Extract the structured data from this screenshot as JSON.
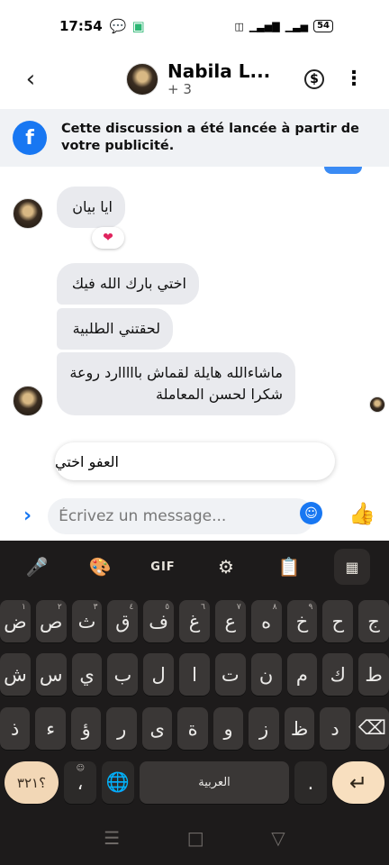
{
  "status": {
    "time": "17:54",
    "battery": "54"
  },
  "header": {
    "title": "Nabila L...",
    "subtitle": "+ 3"
  },
  "banner": {
    "text": "Cette discussion a été lancée à partir de votre publicité."
  },
  "messages": [
    {
      "text": "ايا بيان"
    },
    {
      "text": "اختي بارك الله فيك"
    },
    {
      "text": "لحقتني الطلبية"
    },
    {
      "text": "ماشاءالله هايلة لقماش بااااارد روعة شكرا لحسن المعاملة"
    }
  ],
  "reaction": "❤",
  "quick_reply": "العفو اختي",
  "composer": {
    "placeholder": "Écrivez un message..."
  },
  "keyboard": {
    "toolbar": [
      "mic",
      "palette",
      "GIF",
      "settings",
      "clipboard",
      "grid"
    ],
    "row1": [
      {
        "k": "ج",
        "h": ""
      },
      {
        "k": "ح",
        "h": ""
      },
      {
        "k": "خ",
        "h": "٩"
      },
      {
        "k": "ه",
        "h": "٨"
      },
      {
        "k": "ع",
        "h": "٧"
      },
      {
        "k": "غ",
        "h": "٦"
      },
      {
        "k": "ف",
        "h": "٥"
      },
      {
        "k": "ق",
        "h": "٤"
      },
      {
        "k": "ث",
        "h": "٣"
      },
      {
        "k": "ص",
        "h": "٢"
      },
      {
        "k": "ض",
        "h": "١"
      }
    ],
    "row2": [
      "ط",
      "ك",
      "م",
      "ن",
      "ت",
      "ا",
      "ل",
      "ب",
      "ي",
      "س",
      "ش"
    ],
    "row3": [
      "د",
      "ظ",
      "ز",
      "و",
      "ة",
      "ى",
      "ر",
      "ؤ",
      "ء",
      "ذ"
    ],
    "numbers_label": "؟٣٢١",
    "comma_label": "،",
    "space_label": "العربية",
    "period_label": "."
  },
  "colors": {
    "accent": "#1877f2",
    "bubble": "#e9eaee",
    "keyboard_bg": "#1d1b1b"
  }
}
